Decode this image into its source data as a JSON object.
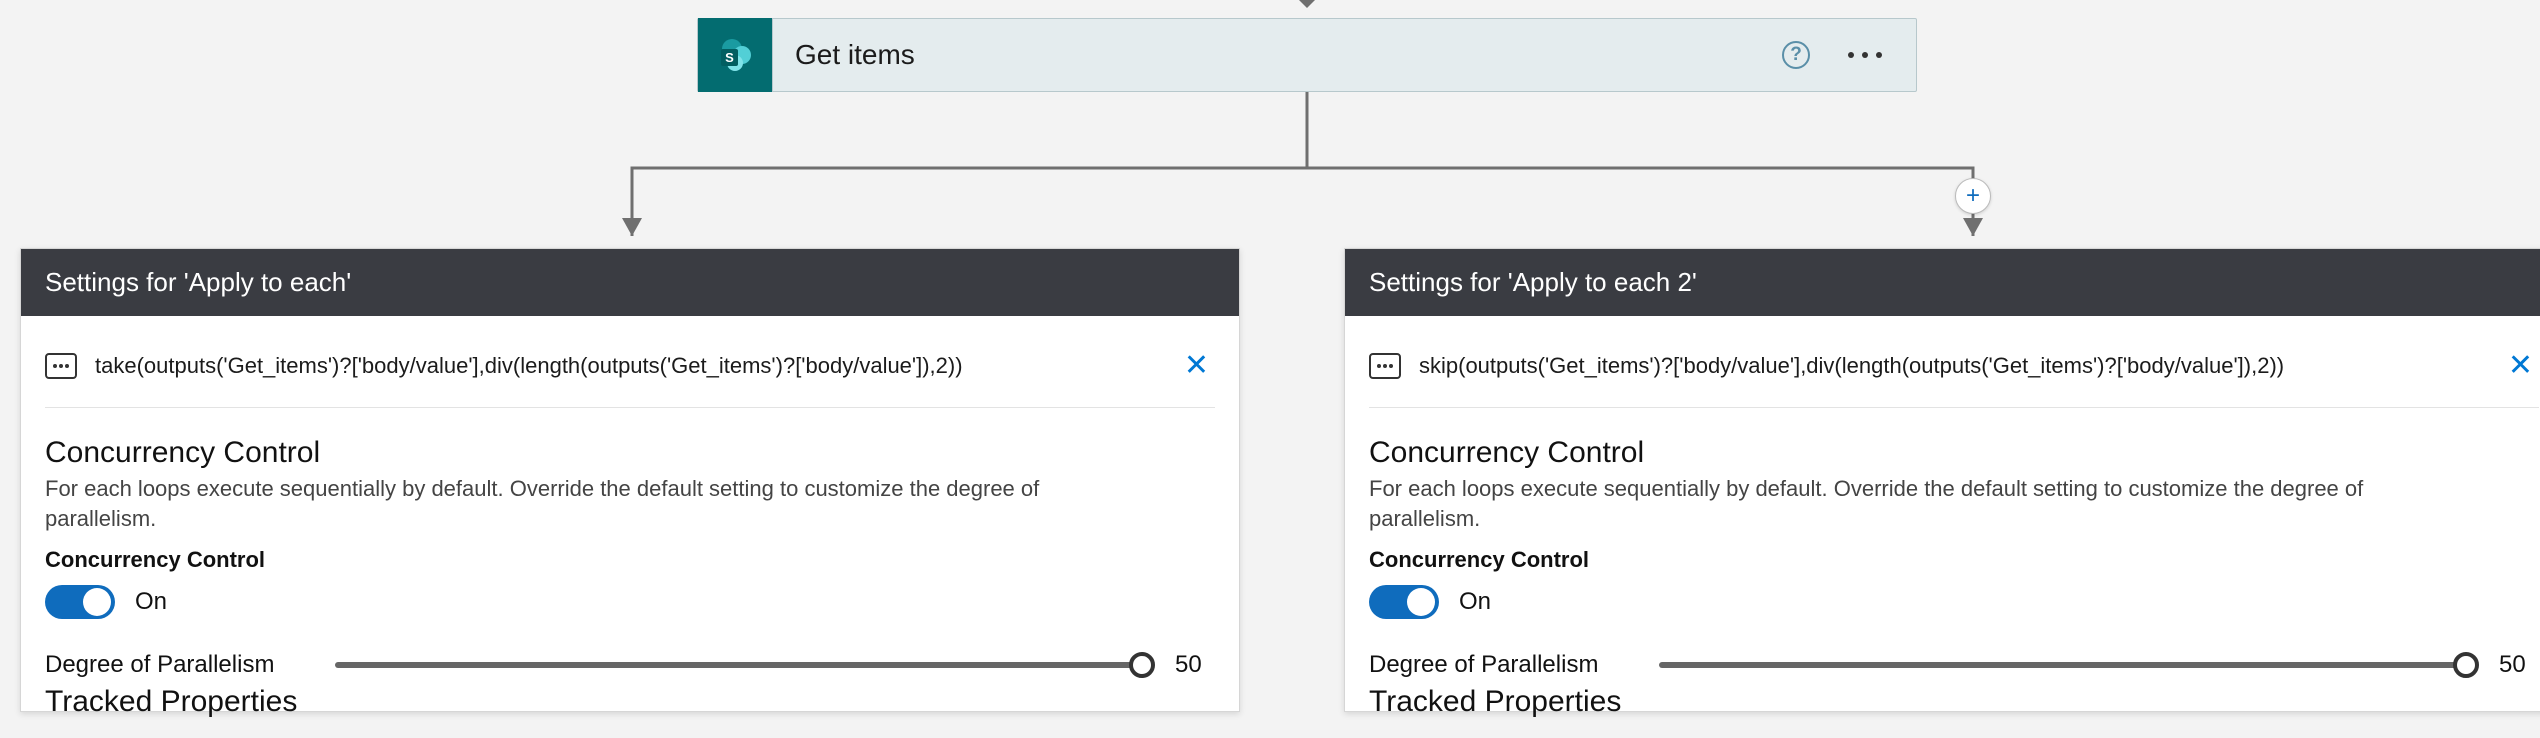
{
  "top_action": {
    "title": "Get items",
    "icon_letter": "S",
    "help": "?"
  },
  "add_button_glyph": "+",
  "panels": [
    {
      "header": "Settings for 'Apply to each'",
      "expression": "take(outputs('Get_items')?['body/value'],div(length(outputs('Get_items')?['body/value']),2))",
      "concurrency_title": "Concurrency Control",
      "concurrency_desc": "For each loops execute sequentially by default. Override the default setting to customize the degree of parallelism.",
      "concurrency_sublabel": "Concurrency Control",
      "toggle_state": "On",
      "dop_label": "Degree of Parallelism",
      "dop_value": "50",
      "tracked_label": "Tracked Properties"
    },
    {
      "header": "Settings for 'Apply to each 2'",
      "expression": "skip(outputs('Get_items')?['body/value'],div(length(outputs('Get_items')?['body/value']),2))",
      "concurrency_title": "Concurrency Control",
      "concurrency_desc": "For each loops execute sequentially by default. Override the default setting to customize the degree of parallelism.",
      "concurrency_sublabel": "Concurrency Control",
      "toggle_state": "On",
      "dop_label": "Degree of Parallelism",
      "dop_value": "50",
      "tracked_label": "Tracked Properties"
    }
  ]
}
